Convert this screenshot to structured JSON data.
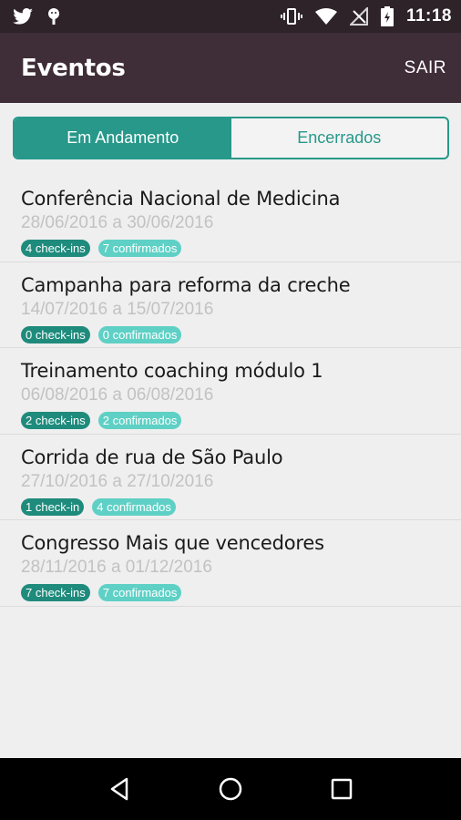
{
  "status_bar": {
    "time": "11:18",
    "icons_left": [
      "twitter-icon",
      "android-icon"
    ],
    "icons_right": [
      "vibrate-icon",
      "wifi-icon",
      "no-signal-icon",
      "battery-icon"
    ]
  },
  "app_bar": {
    "title": "Eventos",
    "action_label": "SAIR",
    "color": "#3f2d38"
  },
  "tabs": [
    {
      "label": "Em Andamento",
      "active": true
    },
    {
      "label": "Encerrados",
      "active": false
    }
  ],
  "accent_color": "#27988a",
  "events": [
    {
      "title": "Conferência Nacional de Medicina",
      "dates": "28/06/2016 a 30/06/2016",
      "checkins": "4 check-ins",
      "confirmed": "7 confirmados"
    },
    {
      "title": "Campanha para reforma da creche",
      "dates": "14/07/2016 a 15/07/2016",
      "checkins": "0 check-ins",
      "confirmed": "0 confirmados"
    },
    {
      "title": "Treinamento coaching módulo 1",
      "dates": "06/08/2016 a 06/08/2016",
      "checkins": "2 check-ins",
      "confirmed": "2 confirmados"
    },
    {
      "title": "Corrida de rua de São Paulo",
      "dates": "27/10/2016 a 27/10/2016",
      "checkins": "1 check-in",
      "confirmed": "4 confirmados"
    },
    {
      "title": "Congresso Mais que vencedores",
      "dates": "28/11/2016 a 01/12/2016",
      "checkins": "7 check-ins",
      "confirmed": "7 confirmados"
    }
  ],
  "nav_bar": {
    "buttons": [
      "back-icon",
      "home-icon",
      "recents-icon"
    ]
  }
}
